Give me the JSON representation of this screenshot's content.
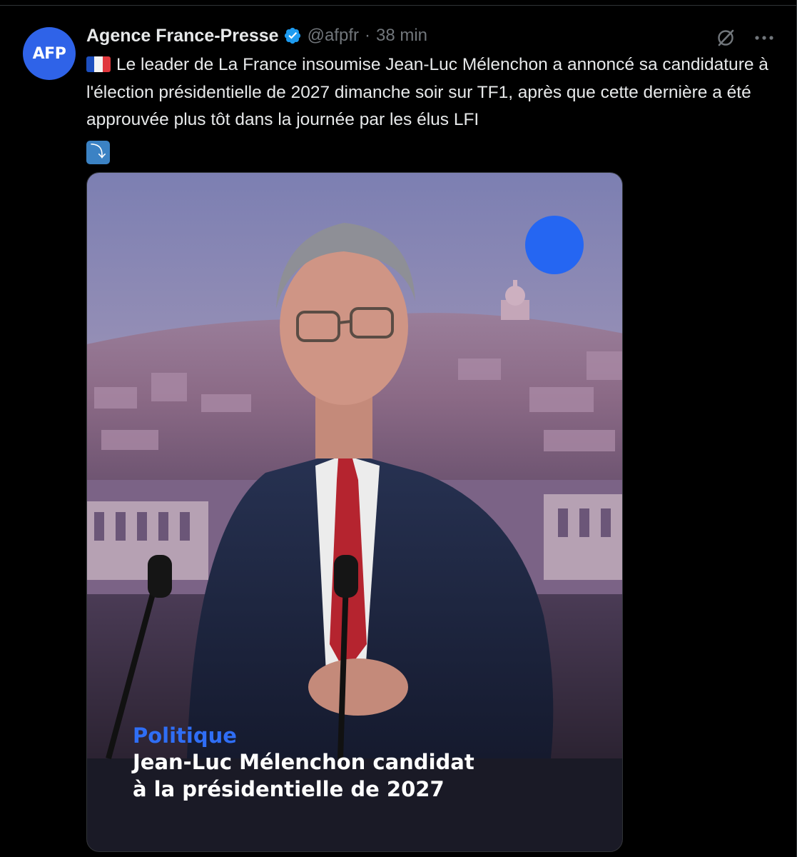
{
  "tweet": {
    "author": {
      "avatar_text": "AFP",
      "name": "Agence France-Presse",
      "verified": true,
      "handle": "@afpfr",
      "separator": "·",
      "time": "38 min"
    },
    "text": "Le leader de La France insoumise Jean-Luc Mélenchon a annoncé sa candidature à l'élection présidentielle de 2027 dimanche soir sur TF1, après que cette dernière a été approuvée plus tôt dans la journée par les élus LFI",
    "emoji_leading": "french-flag",
    "emoji_trailing": "⤵",
    "actions": {
      "grok_icon": "grok-icon",
      "more_icon": "more-icon"
    },
    "media": {
      "caption_tag": "Politique",
      "caption_line1": "Jean-Luc Mélenchon candidat",
      "caption_line2": "à la présidentielle de 2027",
      "accent_color": "#2566f2"
    }
  },
  "colors": {
    "background": "#000000",
    "text_primary": "#e7e9ea",
    "text_secondary": "#71767b",
    "avatar_bg": "#2f63e8",
    "verified_badge": "#1d9bf0"
  }
}
